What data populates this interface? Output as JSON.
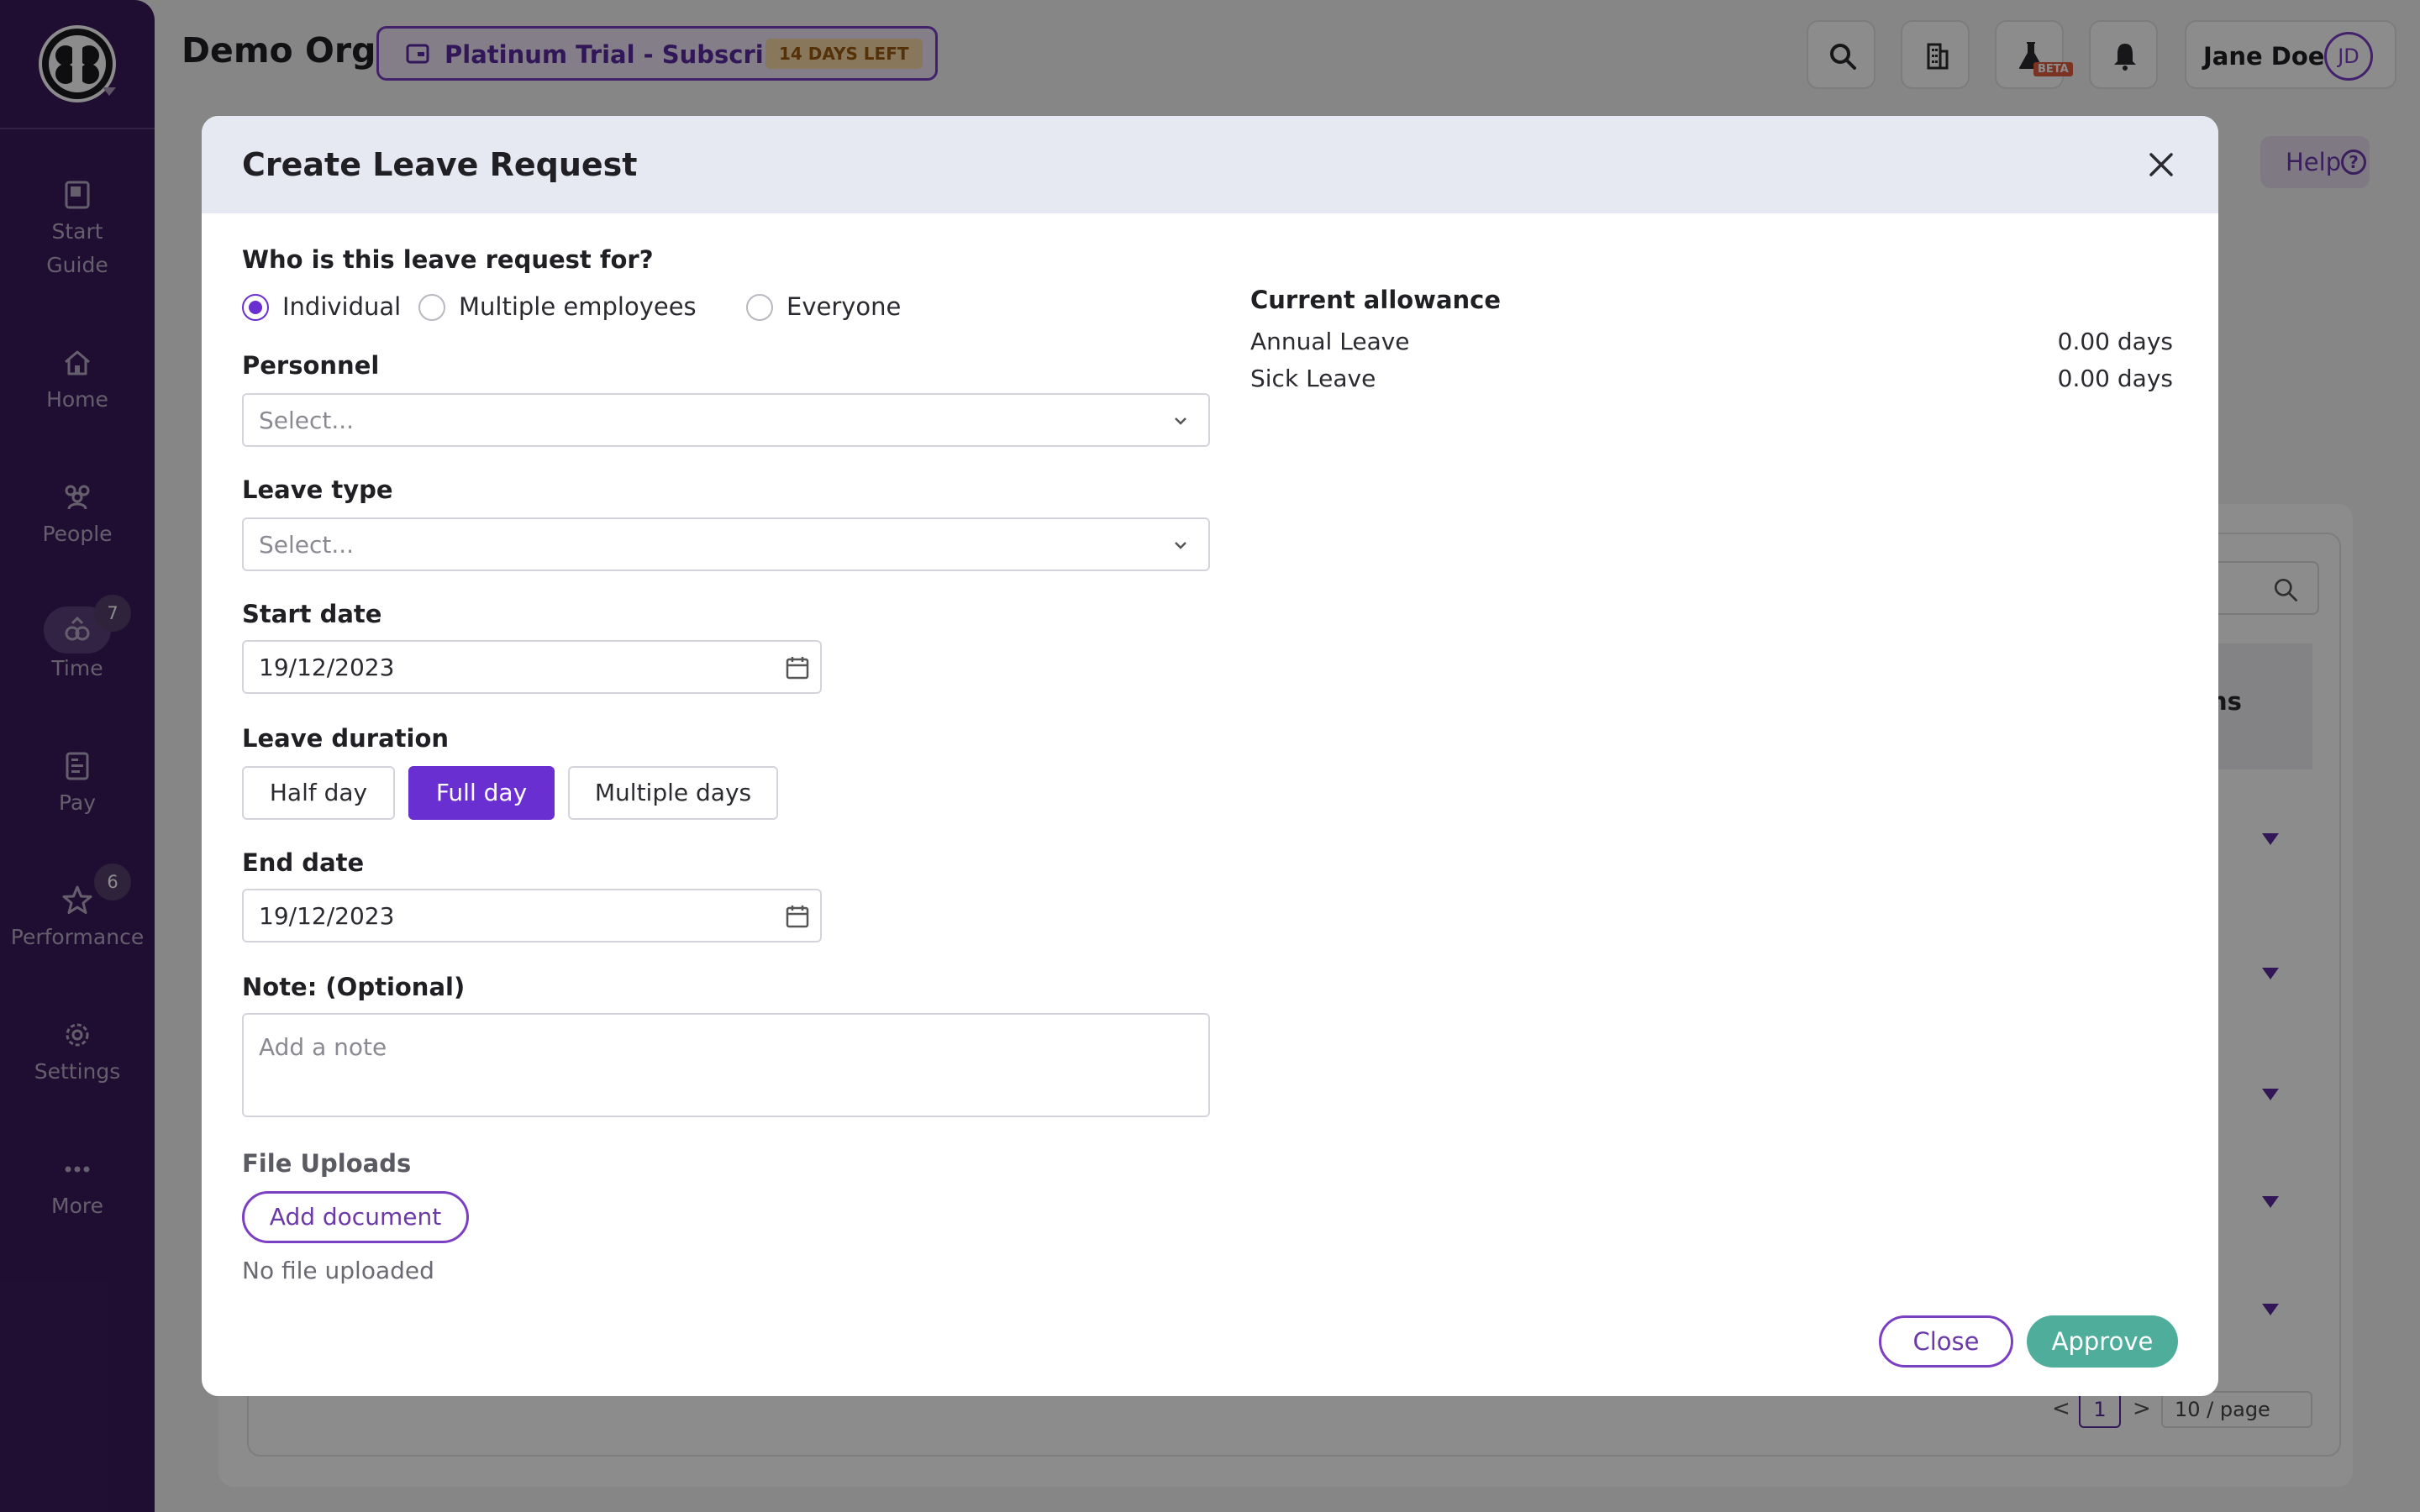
{
  "sidebar": {
    "items": [
      {
        "label": "Start\nGuide",
        "icon": "book-icon"
      },
      {
        "label": "Home",
        "icon": "home-icon"
      },
      {
        "label": "People",
        "icon": "people-icon"
      },
      {
        "label": "Time",
        "icon": "time-icon",
        "badge": "7"
      },
      {
        "label": "Pay",
        "icon": "pay-icon"
      },
      {
        "label": "Performance",
        "icon": "star-icon",
        "badge": "6"
      },
      {
        "label": "Settings",
        "icon": "gear-icon"
      },
      {
        "label": "More",
        "icon": "more-icon"
      }
    ]
  },
  "topbar": {
    "org_name": "Demo Org",
    "trial": {
      "text": "Platinum Trial - Subscribe",
      "days": "14 DAYS LEFT"
    },
    "beta": "BETA",
    "user": {
      "name": "Jane Doe",
      "initials": "JD"
    }
  },
  "background": {
    "help": "Help",
    "help_icon": "?",
    "header_fragment": "ns",
    "row_fragment": "ns",
    "pager": {
      "prev": "<",
      "current": "1",
      "next": ">",
      "page_size": "10 / page"
    }
  },
  "modal": {
    "title": "Create Leave Request",
    "who_label": "Who is this leave request for?",
    "who_options": [
      "Individual",
      "Multiple employees",
      "Everyone"
    ],
    "who_selected": "Individual",
    "personnel_label": "Personnel",
    "personnel_placeholder": "Select...",
    "leave_type_label": "Leave type",
    "leave_type_placeholder": "Select...",
    "start_date_label": "Start date",
    "start_date": "19/12/2023",
    "duration_label": "Leave duration",
    "duration_options": [
      "Half day",
      "Full day",
      "Multiple days"
    ],
    "duration_selected": "Full day",
    "end_date_label": "End date",
    "end_date": "19/12/2023",
    "note_label": "Note: (Optional)",
    "note_placeholder": "Add a note",
    "uploads_label": "File Uploads",
    "add_document": "Add document",
    "no_file": "No file uploaded",
    "allowance": {
      "title": "Current allowance",
      "rows": [
        {
          "name": "Annual Leave",
          "value": "0.00 days"
        },
        {
          "name": "Sick Leave",
          "value": "0.00 days"
        }
      ]
    },
    "close_button": "Close",
    "approve_button": "Approve"
  },
  "colors": {
    "sidebar": "#3b1a5c",
    "accent": "#6a2fd0",
    "approve": "#4fae9b",
    "trial_badge": "#f7d9a5"
  }
}
